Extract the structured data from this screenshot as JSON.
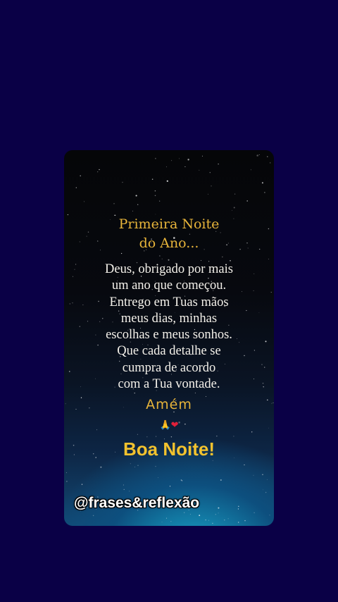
{
  "card": {
    "title": "Primeira Noite\ndo Ano...",
    "body": "Deus, obrigado por mais\num ano que começou.\nEntrego em Tuas mãos\nmeus dias, minhas\nescolhas e meus sonhos.\nQue cada detalhe se\ncumpra de acordo\ncom a Tua vontade.",
    "amen": "Amém",
    "emoji_hands": "🙏",
    "emoji_heart": "❤",
    "greeting": "Boa Noite!",
    "handle": "@frases&reflexão"
  },
  "colors": {
    "background": "#0a0046",
    "gold": "#e7b43a",
    "greeting_yellow": "#f2c22e",
    "body_text": "#f4f1ea"
  }
}
